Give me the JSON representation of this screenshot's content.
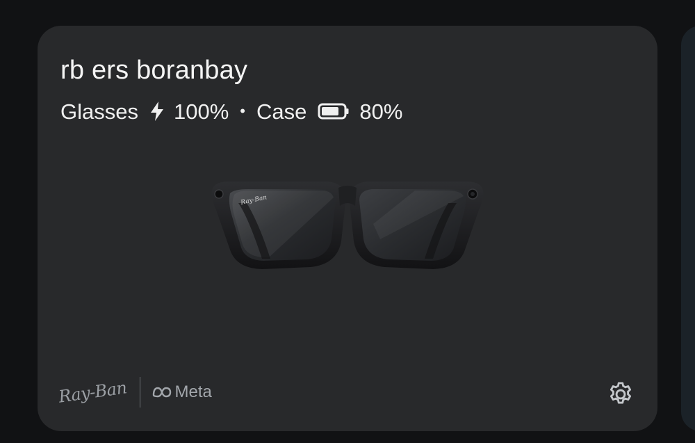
{
  "device": {
    "name": "rb ers boranbay",
    "glasses_label": "Glasses",
    "glasses_battery": "100%",
    "separator": "•",
    "case_label": "Case",
    "case_battery": "80%",
    "charging_icon": "lightning-bolt-icon",
    "case_battery_icon": "battery-icon",
    "case_battery_level": 0.8
  },
  "brands": {
    "rayban": "Ray-Ban",
    "meta": "Meta"
  },
  "icons": {
    "settings": "gear-icon"
  },
  "colors": {
    "background": "#111214",
    "card": "#28292b",
    "text_primary": "#f5f5f5",
    "text_muted": "#9a9ea3"
  }
}
